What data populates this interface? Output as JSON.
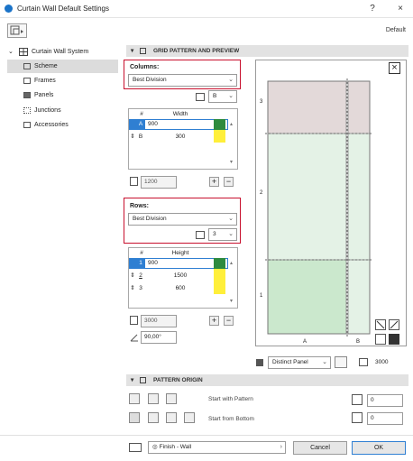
{
  "window": {
    "title": "Curtain Wall Default Settings",
    "help": "?",
    "close": "×"
  },
  "preset": "Default",
  "sidebar": {
    "root": "Curtain Wall System",
    "items": [
      {
        "label": "Scheme"
      },
      {
        "label": "Frames"
      },
      {
        "label": "Panels"
      },
      {
        "label": "Junctions"
      },
      {
        "label": "Accessories"
      }
    ]
  },
  "grid_section": {
    "title": "GRID PATTERN AND PREVIEW"
  },
  "columns": {
    "label": "Columns:",
    "mode": "Best Division",
    "count": "B",
    "header_num": "#",
    "header_width": "Width",
    "rows": [
      {
        "num": "A",
        "value": "900"
      },
      {
        "num": "B",
        "value": "300"
      }
    ],
    "total": "1200"
  },
  "rows": {
    "label": "Rows:",
    "mode": "Best Division",
    "count": "3",
    "header_num": "#",
    "header_height": "Height",
    "rows": [
      {
        "num": "1",
        "value": "900"
      },
      {
        "num": "2",
        "value": "1500"
      },
      {
        "num": "3",
        "value": "600"
      }
    ],
    "total": "3000",
    "angle": "90,00°"
  },
  "preview": {
    "row_labels": [
      "3",
      "2",
      "1"
    ],
    "col_labels": [
      "A",
      "B"
    ]
  },
  "panel_type": {
    "value": "Distinct Panel",
    "total": "3000"
  },
  "origin_section": {
    "title": "PATTERN ORIGIN",
    "start_pattern": "Start with Pattern",
    "start_bottom": "Start from Bottom",
    "offset1": "0",
    "offset2": "0"
  },
  "footer": {
    "layer": "Finish - Wall",
    "cancel": "Cancel",
    "ok": "OK"
  }
}
